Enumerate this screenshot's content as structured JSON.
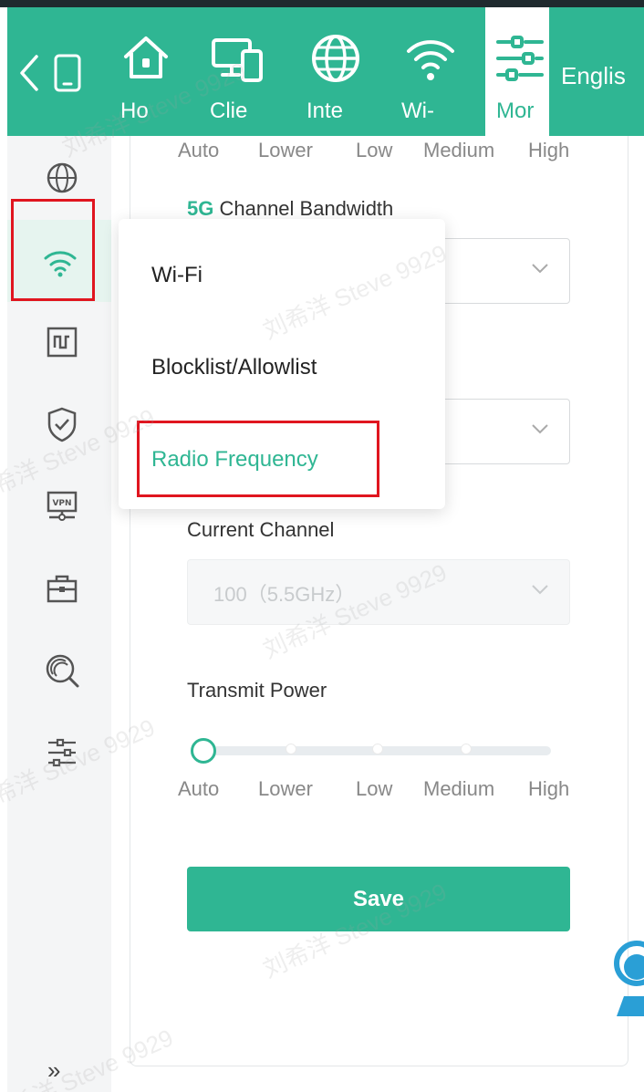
{
  "topnav": {
    "items": [
      {
        "label": "Ho",
        "icon": "home-icon"
      },
      {
        "label": "Clie",
        "icon": "clients-icon"
      },
      {
        "label": "Inte",
        "icon": "internet-globe-icon"
      },
      {
        "label": "Wi-",
        "icon": "wifi-icon"
      },
      {
        "label": "Mor",
        "icon": "more-settings-icon"
      }
    ],
    "language": "Englis",
    "active_item": "Mor"
  },
  "sidebar": {
    "items": [
      {
        "icon": "globe-icon"
      },
      {
        "icon": "wifi-icon"
      },
      {
        "icon": "network-icon"
      },
      {
        "icon": "shield-icon"
      },
      {
        "icon": "vpn-icon"
      },
      {
        "icon": "toolbox-icon"
      },
      {
        "icon": "diagnostics-icon"
      },
      {
        "icon": "settings-sliders-icon"
      }
    ],
    "active_item": "wifi-icon",
    "expand_label": "»"
  },
  "top_slider_labels": [
    "Auto",
    "Lower",
    "Low",
    "Medium",
    "High"
  ],
  "bandwidth": {
    "label_highlight": "5G",
    "label_rest": " Channel Bandwidth"
  },
  "current_channel": {
    "label": "Current Channel",
    "value": "100（5.5GHz）"
  },
  "transmit_power": {
    "label": "Transmit Power",
    "levels": [
      "Auto",
      "Lower",
      "Low",
      "Medium",
      "High"
    ],
    "selected": "Auto"
  },
  "save_label": "Save",
  "dropdown_menu": {
    "items": [
      "Wi-Fi",
      "Blocklist/Allowlist",
      "Radio Frequency"
    ],
    "active": "Radio Frequency"
  },
  "watermark_text": "刘希洋 Steve 9929",
  "colors": {
    "accent": "#2fb693",
    "highlight_box": "#e0151f",
    "sidebar_bg": "#f4f5f6"
  }
}
